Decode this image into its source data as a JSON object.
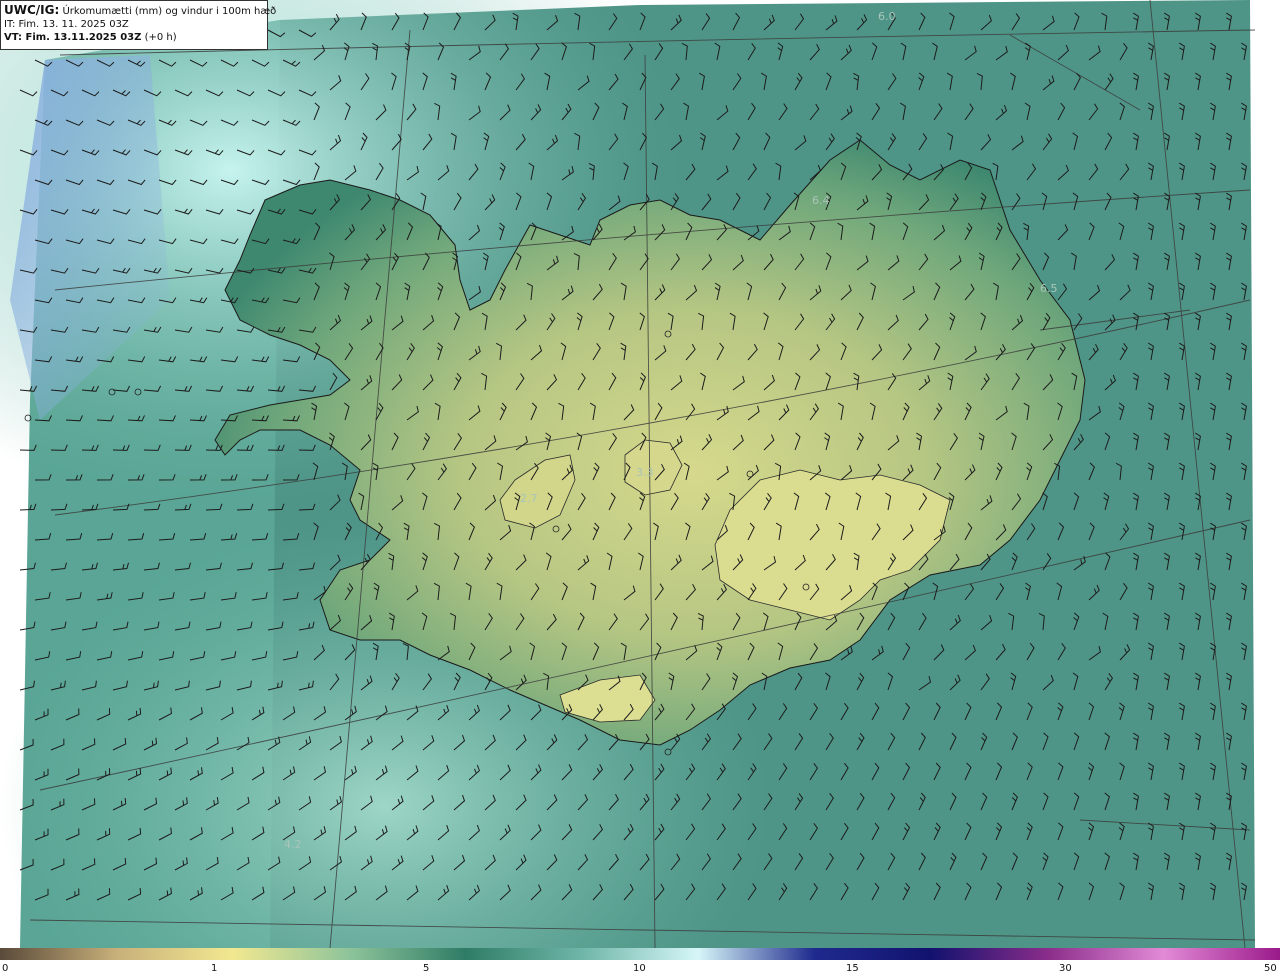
{
  "header": {
    "model": "UWC/IG:",
    "description": "Úrkomumætti (mm) og vindur i 100m hæð",
    "initial_time": "IT: Fim. 13. 11. 2025 03Z",
    "valid_time": "VT: Fim. 13.11.2025 03Z",
    "lead_time": "(+0 h)"
  },
  "map": {
    "contour_labels": [
      "6.0",
      "6.4",
      "6.5",
      "2.7",
      "3.3",
      "4.2"
    ],
    "colors": {
      "sea": "#4f9587",
      "sea_light": "#b9eee8",
      "land_high": "#d4d88a",
      "land_mid": "#9cb97c",
      "land_low": "#3f8a72",
      "blue_corner": "#8cb3de",
      "coast_line": "#1a1a1a",
      "barb": "#1c1c1c"
    }
  },
  "colorbar": {
    "ticks": [
      "0",
      "1",
      "5",
      "10",
      "15",
      "30",
      "50"
    ],
    "stops": [
      "#5a4a3a",
      "#c8b07a",
      "#f2e890",
      "#8ec49a",
      "#2f7c66",
      "#6fb6a8",
      "#d6f6f8",
      "#1f2a8e",
      "#12126e",
      "#8a2d8a",
      "#e28ad6",
      "#9a1a8a"
    ]
  }
}
